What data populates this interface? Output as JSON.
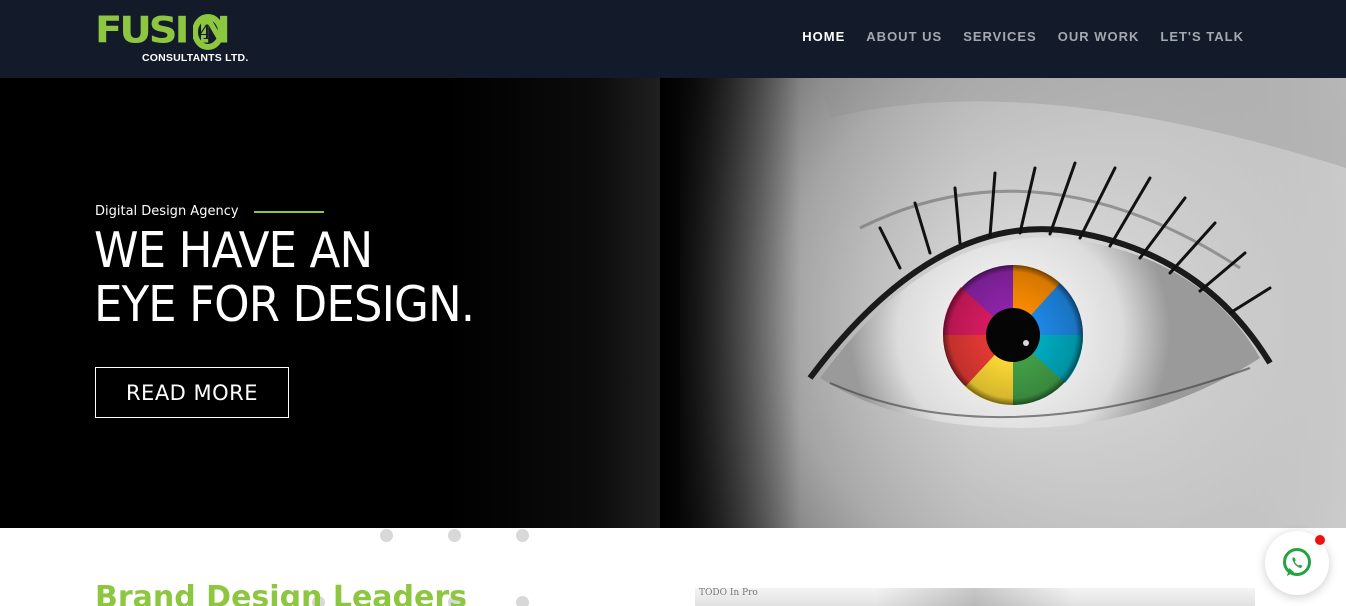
{
  "brand": {
    "logo_word": "FUSI N",
    "logo_four": "4",
    "logo_sub": "CONSULTANTS LTD.",
    "accent_color": "#8dc63f",
    "nav_bg": "#131b2a"
  },
  "nav": {
    "items": [
      {
        "label": "HOME",
        "active": true
      },
      {
        "label": "ABOUT US",
        "active": false
      },
      {
        "label": "SERVICES",
        "active": false
      },
      {
        "label": "OUR WORK",
        "active": false
      },
      {
        "label": "LET'S TALK",
        "active": false
      }
    ]
  },
  "hero": {
    "eyebrow": "Digital Design Agency",
    "headline_line1": "WE HAVE AN",
    "headline_line2": "EYE FOR DESIGN.",
    "cta_label": "READ MORE",
    "image": "grayscale-eye-with-rainbow-iris"
  },
  "section": {
    "title": "Brand Design Leaders",
    "image_text": "TODO   In Pro"
  },
  "chat": {
    "icon": "whatsapp-icon",
    "badge_color": "#ee1111"
  }
}
